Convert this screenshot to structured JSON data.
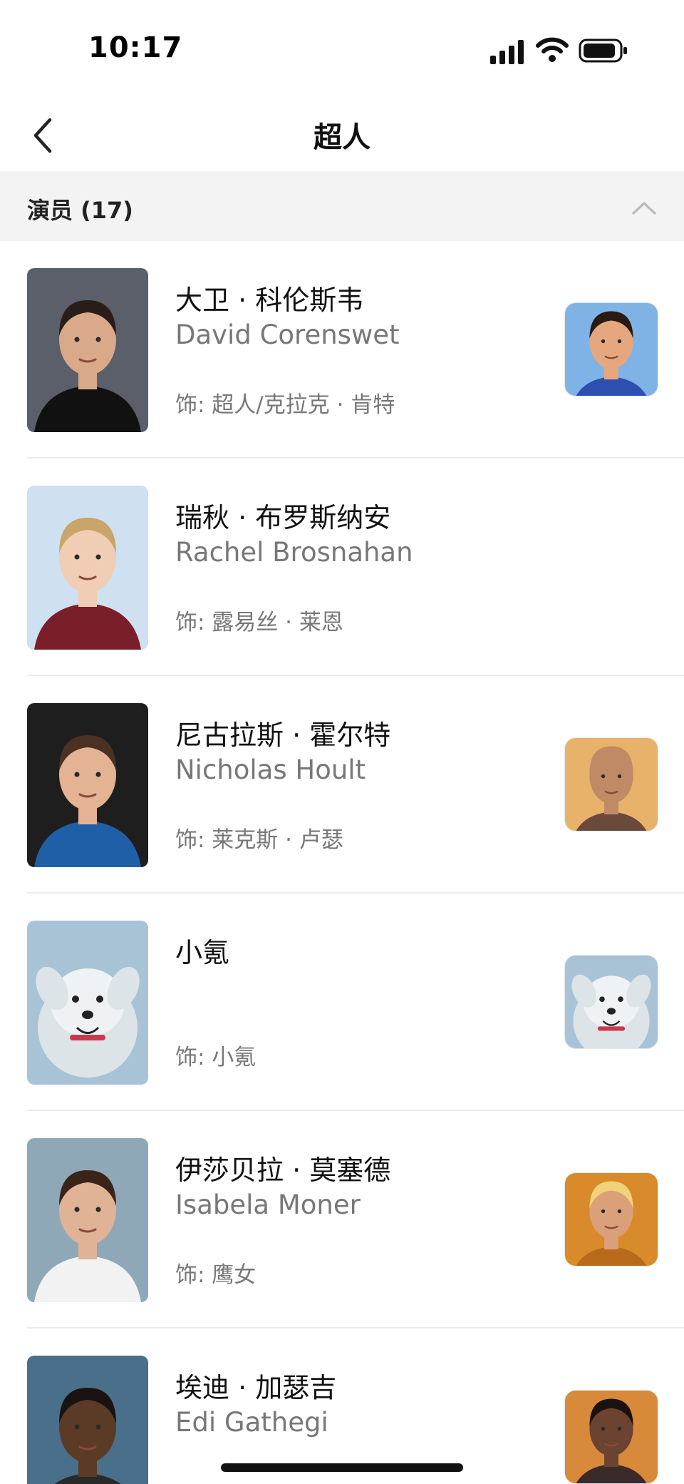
{
  "status_bar": {
    "time": "10:17"
  },
  "nav": {
    "title": "超人"
  },
  "section": {
    "title": "演员 (17)"
  },
  "cast": [
    {
      "name_cn": "大卫 · 科伦斯韦",
      "name_en": "David Corenswet",
      "role": "饰: 超人/克拉克 · 肯特",
      "photo_icon": "actor-headshot",
      "character_icon": "superman-character",
      "photo_colors": {
        "bg": "#5a5f6a",
        "skin": "#d9a98a",
        "hair": "#2a1d18",
        "clothes": "#111111"
      },
      "thumb_colors": {
        "bg": "#7fb3e6",
        "skin": "#e6a77e",
        "hair": "#2a1a12",
        "clothes": "#2d4fb0"
      }
    },
    {
      "name_cn": "瑞秋 · 布罗斯纳安",
      "name_en": "Rachel Brosnahan",
      "role": "饰: 露易丝 · 莱恩",
      "photo_icon": "actor-headshot",
      "character_icon": null,
      "photo_colors": {
        "bg": "#cfe0f0",
        "skin": "#f0cdb4",
        "hair": "#c9a56a",
        "clothes": "#7a1f2a"
      },
      "thumb_colors": null
    },
    {
      "name_cn": "尼古拉斯 · 霍尔特",
      "name_en": "Nicholas Hoult",
      "role": "饰: 莱克斯 · 卢瑟",
      "photo_icon": "actor-headshot",
      "character_icon": "lex-luthor-character",
      "photo_colors": {
        "bg": "#1e1e1e",
        "skin": "#e3b394",
        "hair": "#4a3222",
        "clothes": "#1f5fa8"
      },
      "thumb_colors": {
        "bg": "#e9b26a",
        "skin": "#c08a66",
        "hair": "#c08a66",
        "clothes": "#6a4a3a"
      }
    },
    {
      "name_cn": "小氪",
      "name_en": "",
      "role": "饰: 小氪",
      "photo_icon": "dog-photo",
      "character_icon": "krypto-character",
      "photo_colors": {
        "bg": "#a9c3d6",
        "skin": "#eef2f4",
        "hair": "#dde4e8",
        "clothes": "#c53b4b"
      },
      "thumb_colors": {
        "bg": "#a9c3d6",
        "skin": "#eef2f4",
        "hair": "#dde4e8",
        "clothes": "#c53b4b"
      }
    },
    {
      "name_cn": "伊莎贝拉 · 莫塞德",
      "name_en": "Isabela Moner",
      "role": "饰: 鹰女",
      "photo_icon": "actor-headshot",
      "character_icon": "hawkgirl-character",
      "photo_colors": {
        "bg": "#8ea8b8",
        "skin": "#e0b296",
        "hair": "#3a2418",
        "clothes": "#f2f2f2"
      },
      "thumb_colors": {
        "bg": "#d98a2a",
        "skin": "#d9a07a",
        "hair": "#f1d27a",
        "clothes": "#b86a1a"
      }
    },
    {
      "name_cn": "埃迪 · 加瑟吉",
      "name_en": "Edi Gathegi",
      "role": "",
      "photo_icon": "actor-headshot",
      "character_icon": "mister-terrific-character",
      "photo_colors": {
        "bg": "#4a6f8a",
        "skin": "#5b3a26",
        "hair": "#1a1210",
        "clothes": "#2a2a2a"
      },
      "thumb_colors": {
        "bg": "#d8893a",
        "skin": "#6b4330",
        "hair": "#1a1210",
        "clothes": "#3a2a2a"
      }
    }
  ]
}
